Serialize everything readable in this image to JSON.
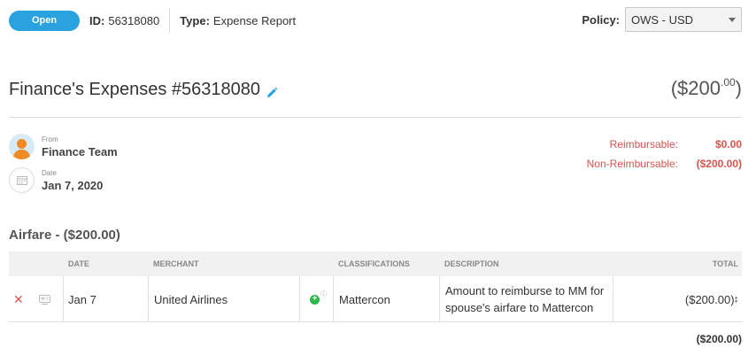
{
  "header": {
    "status_label": "Open",
    "id_key": "ID:",
    "id_value": "56318080",
    "type_key": "Type:",
    "type_value": "Expense Report",
    "policy_key": "Policy:",
    "policy_value": "OWS - USD"
  },
  "report": {
    "title": "Finance's Expenses #56318080",
    "total_main": "($200",
    "total_cents": ".00",
    "total_close": ")"
  },
  "from": {
    "label": "From",
    "value": "Finance Team"
  },
  "date": {
    "label": "Date",
    "value": "Jan 7, 2020"
  },
  "summary": {
    "reimbursable_label": "Reimbursable:",
    "reimbursable_value": "$0.00",
    "non_reimbursable_label": "Non-Reimbursable:",
    "non_reimbursable_value": "($200.00)"
  },
  "section": {
    "title": "Airfare - ($200.00)"
  },
  "table": {
    "columns": {
      "date": "DATE",
      "merchant": "MERCHANT",
      "classifications": "CLASSIFICATIONS",
      "description": "DESCRIPTION",
      "total": "TOTAL"
    },
    "rows": [
      {
        "date": "Jan 7",
        "merchant": "United Airlines",
        "classification": "Mattercon",
        "description_line1": "Amount to reimburse to MM for",
        "description_line2": "spouse's airfare to Mattercon",
        "total": "($200.00)",
        "total_marker": "‡"
      }
    ],
    "footer_total": "($200.00)"
  },
  "colors": {
    "accent": "#2aa2e0",
    "negative": "#d9534f",
    "add": "#2db84b",
    "avatar": "#f08a24"
  }
}
